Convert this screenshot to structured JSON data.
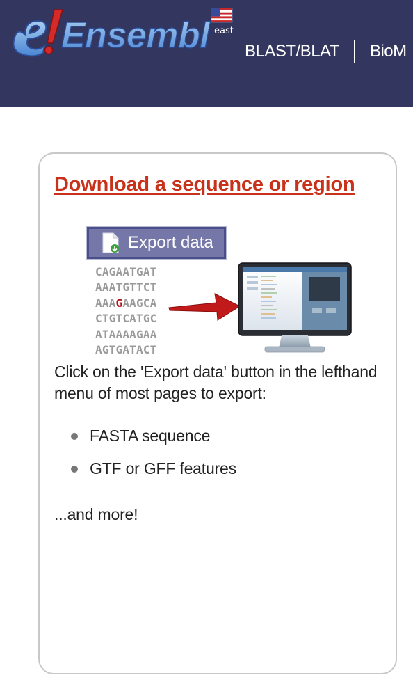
{
  "header": {
    "logo_brand": "Ensembl",
    "logo_subtitle": "east",
    "logo_icon": "flag-icon",
    "nav": [
      {
        "label": "BLAST/BLAT"
      },
      {
        "label": "BioM"
      }
    ],
    "background_color": "#33365f"
  },
  "panel": {
    "title": "Download a sequence or region",
    "title_color": "#c8321a",
    "illustration": {
      "export_button_label": "Export data",
      "export_icon": "document-download-icon",
      "sequences": [
        "CAGAATGAT",
        "AAATGTTCT",
        "AAAGAAGCA",
        "CTGTCATGC",
        "ATAAAAGAA",
        "AGTGATACT"
      ],
      "highlight": {
        "row": 2,
        "prefix": "AAA",
        "letter": "G",
        "suffix": "AAGCA"
      },
      "arrow_icon": "right-arrow-icon",
      "monitor_icon": "monitor-icon"
    },
    "description": "Click on the 'Export data' button in the lefthand menu of most pages to export:",
    "features": [
      "FASTA sequence",
      "GTF or GFF features"
    ],
    "more": "...and more!"
  }
}
